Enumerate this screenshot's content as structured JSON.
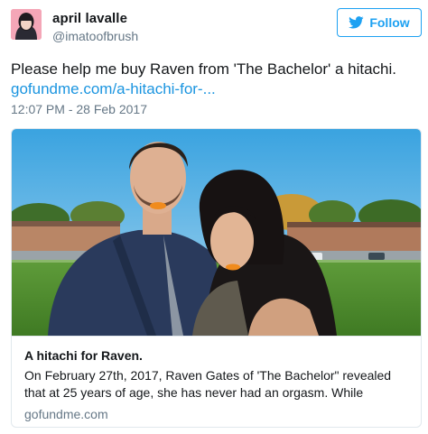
{
  "user": {
    "display_name": "april lavalle",
    "handle": "@imatoofbrush"
  },
  "follow_button": {
    "label": "Follow",
    "icon": "twitter-bird-icon"
  },
  "tweet": {
    "text": "Please help me buy Raven from 'The Bachelor' a hitachi.",
    "link_text": "gofundme.com/a-hitachi-for-...",
    "timestamp": "12:07 PM - 28 Feb 2017"
  },
  "card": {
    "title": "A hitachi for Raven.",
    "description": "On February 27th, 2017, Raven Gates of 'The Bachelor\" revealed that at 25 years of age, she has never had an orgasm.  While",
    "domain": "gofundme.com"
  },
  "colors": {
    "accent": "#1da1f2",
    "link": "#1b95e0",
    "secondary_text": "#657786",
    "border": "#e1e8ed"
  }
}
